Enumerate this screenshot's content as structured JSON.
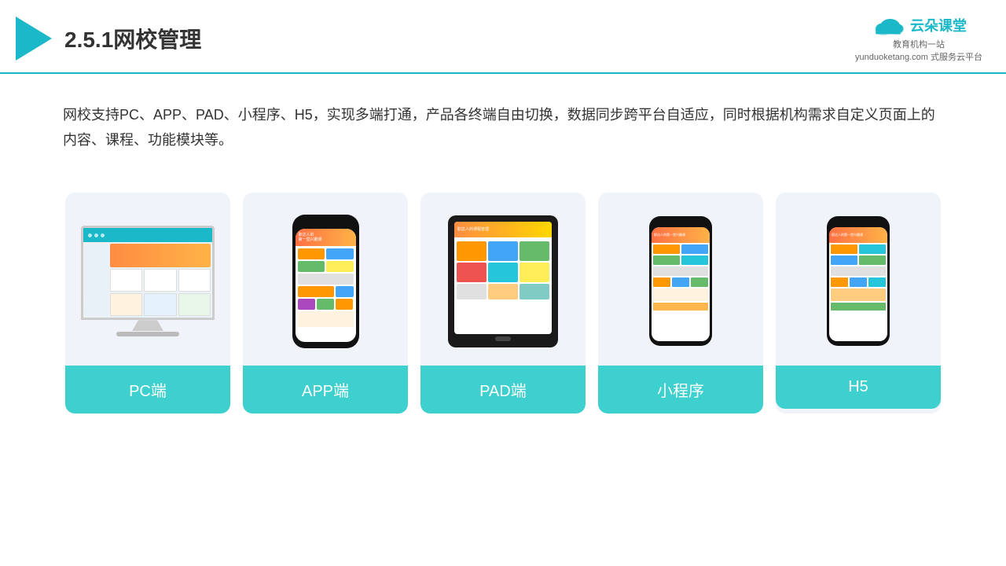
{
  "header": {
    "title": "2.5.1网校管理",
    "brand_name": "云朵课堂",
    "brand_url": "yunduoketang.com",
    "brand_sub_line1": "教育机构一站",
    "brand_sub_line2": "式服务云平台"
  },
  "description": {
    "text": "网校支持PC、APP、PAD、小程序、H5，实现多端打通，产品各终端自由切换，数据同步跨平台自适应，同时根据机构需求自定义页面上的内容、课程、功能模块等。"
  },
  "cards": [
    {
      "id": "pc",
      "label": "PC端"
    },
    {
      "id": "app",
      "label": "APP端"
    },
    {
      "id": "pad",
      "label": "PAD端"
    },
    {
      "id": "miniprogram",
      "label": "小程序"
    },
    {
      "id": "h5",
      "label": "H5"
    }
  ],
  "accent_color": "#3ecfcf"
}
